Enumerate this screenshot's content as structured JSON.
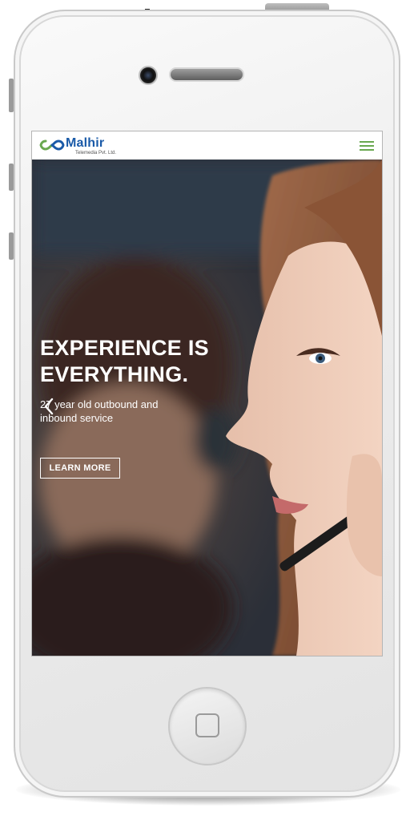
{
  "site": {
    "brand_name": "Malhir",
    "brand_tagline": "Telemedia Pvt. Ltd.",
    "brand_colors": {
      "primary": "#1a5aa8",
      "accent": "#6aa84f"
    },
    "menu_icon": "hamburger-menu-icon"
  },
  "hero": {
    "title_line1": "EXPERIENCE IS",
    "title_line2": "EVERYTHING.",
    "subtitle": "27 year old outbound and inbound service",
    "cta_label": "LEARN MORE",
    "prev_icon": "chevron-left-icon"
  }
}
